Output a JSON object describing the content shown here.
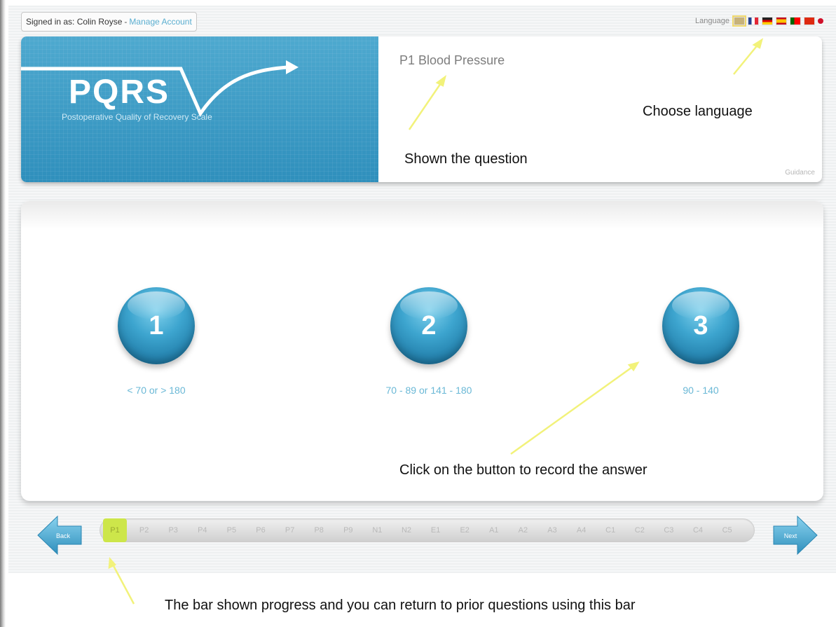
{
  "session": {
    "signed_in_text": "Signed in as: Colin Royse",
    "separator": "-",
    "manage_account": "Manage Account"
  },
  "language": {
    "label": "Language",
    "flags": [
      "english-flag",
      "french-flag",
      "german-flag",
      "spanish-flag",
      "portuguese-flag",
      "chinese-flag",
      "japanese-flag"
    ]
  },
  "brand": {
    "logo": "PQRS",
    "subtitle": "Postoperative Quality of Recovery Scale",
    "color": "#3a9bc6"
  },
  "question": {
    "title": "P1 Blood Pressure",
    "guidance": "Guidance"
  },
  "answers": [
    {
      "number": "1",
      "label": "< 70 or > 180"
    },
    {
      "number": "2",
      "label": "70 - 89 or 141 - 180"
    },
    {
      "number": "3",
      "label": "90 - 140"
    }
  ],
  "progress": {
    "steps": [
      "P1",
      "P2",
      "P3",
      "P4",
      "P5",
      "P6",
      "P7",
      "P8",
      "P9",
      "N1",
      "N2",
      "E1",
      "E2",
      "A1",
      "A2",
      "A3",
      "A4",
      "C1",
      "C2",
      "C3",
      "C4",
      "C5"
    ],
    "active": "P1",
    "back": "Back",
    "next": "Next"
  },
  "annotations": {
    "question": "Shown the question",
    "language": "Choose language",
    "answer": "Click on the button to record the answer",
    "progress": "The bar shown progress and you can return to prior questions using this bar"
  },
  "colors": {
    "arrow": "#f2f27a",
    "active_step": "#cde64a",
    "answer_label": "#6ab8d6"
  }
}
